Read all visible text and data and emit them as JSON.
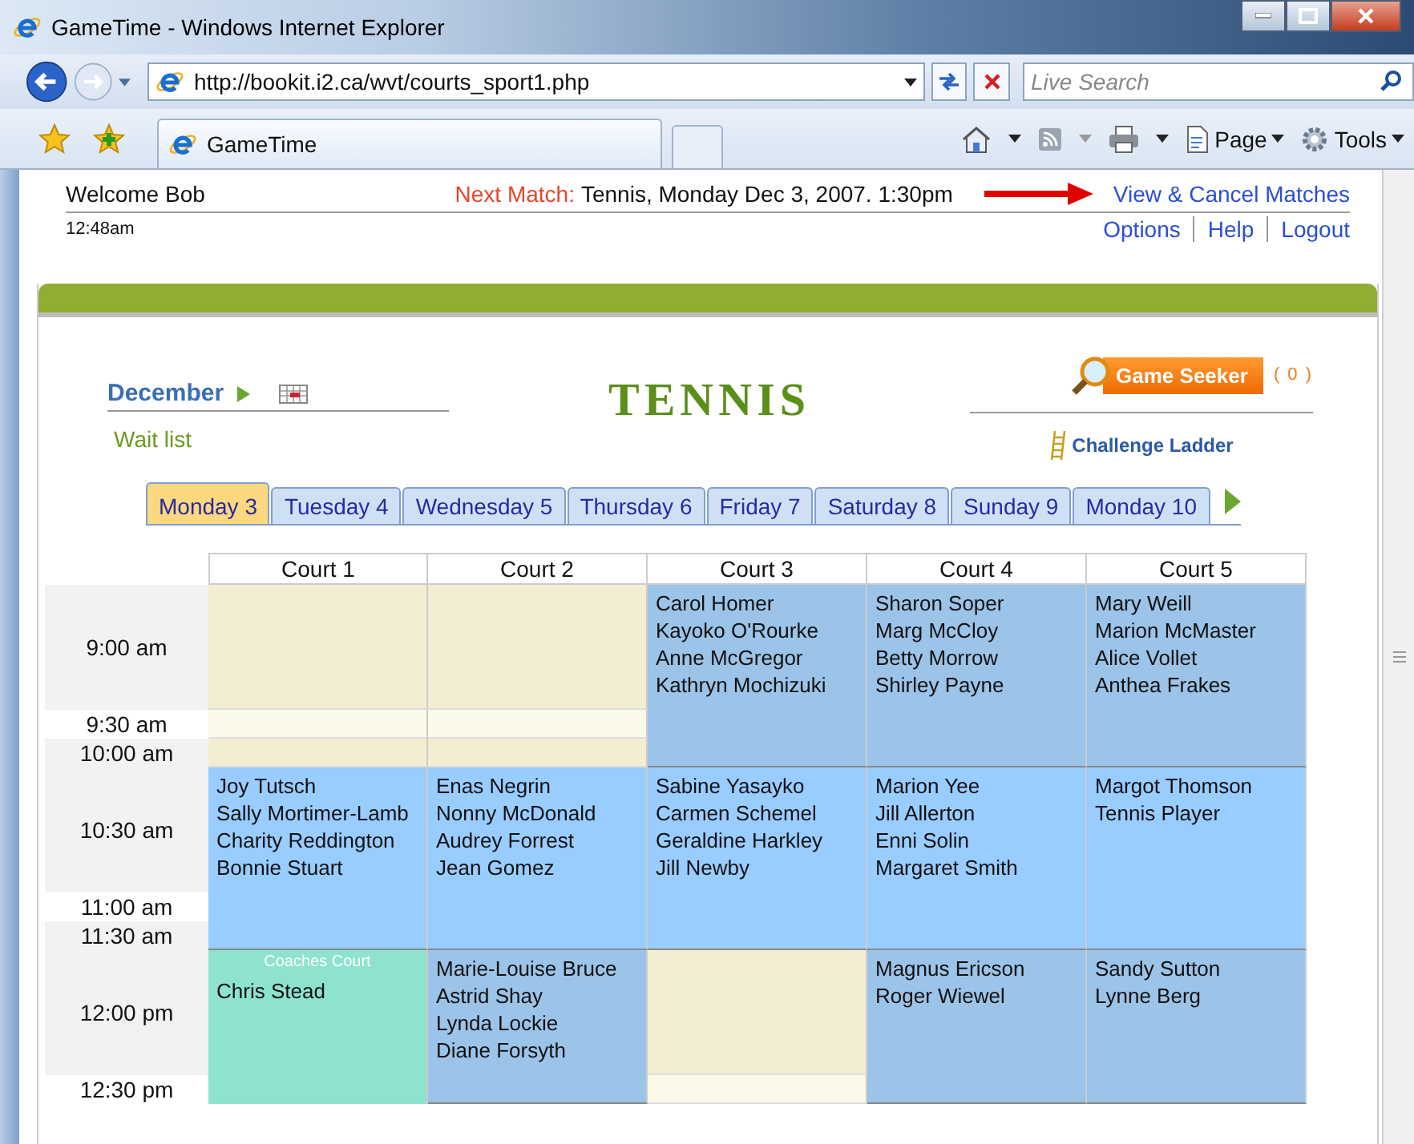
{
  "window": {
    "title": "GameTime - Windows Internet Explorer"
  },
  "address_bar": {
    "url": "http://bookit.i2.ca/wvt/courts_sport1.php",
    "search_placeholder": "Live Search"
  },
  "browser_tab": {
    "title": "GameTime"
  },
  "command_bar": [
    {
      "label": "Page",
      "kind": "page"
    },
    {
      "label": "Tools",
      "kind": "tools"
    }
  ],
  "header": {
    "welcome": "Welcome Bob",
    "time": "12:48am",
    "next_match_label": "Next Match:",
    "next_match": "Tennis, Monday Dec 3, 2007. 1:30pm",
    "view_link": "View & Cancel Matches",
    "nav": [
      "Options",
      "Help",
      "Logout"
    ]
  },
  "panel": {
    "month": "December",
    "wait_list": "Wait list",
    "sport": "TENNIS",
    "game_seeker": "Game Seeker",
    "seeker_count": "( 0 )",
    "challenge_ladder": "Challenge Ladder"
  },
  "days": [
    {
      "label": "Monday 3",
      "selected": true
    },
    {
      "label": "Tuesday 4",
      "selected": false
    },
    {
      "label": "Wednesday 5",
      "selected": false
    },
    {
      "label": "Thursday 6",
      "selected": false
    },
    {
      "label": "Friday 7",
      "selected": false
    },
    {
      "label": "Saturday 8",
      "selected": false
    },
    {
      "label": "Sunday 9",
      "selected": false
    },
    {
      "label": "Monday 10",
      "selected": false
    }
  ],
  "schedule": {
    "columns": [
      "Court 1",
      "Court 2",
      "Court 3",
      "Court 4",
      "Court 5"
    ],
    "blocks": [
      {
        "times": [
          "9:00 am",
          "9:30 am",
          "10:00 am"
        ],
        "cells": [
          {
            "kind": "open"
          },
          {
            "kind": "open"
          },
          {
            "kind": "booked",
            "players": [
              "Carol Homer",
              "Kayoko O'Rourke",
              "Anne McGregor",
              "Kathryn Mochizuki"
            ]
          },
          {
            "kind": "booked",
            "players": [
              "Sharon Soper",
              "Marg McCloy",
              "Betty Morrow",
              "Shirley Payne"
            ]
          },
          {
            "kind": "booked",
            "players": [
              "Mary Weill",
              "Marion McMaster",
              "Alice Vollet",
              "Anthea Frakes"
            ]
          }
        ]
      },
      {
        "times": [
          "10:30 am",
          "11:00 am",
          "11:30 am"
        ],
        "cells": [
          {
            "kind": "booked",
            "players": [
              "Joy Tutsch",
              "Sally Mortimer-Lamb",
              "Charity Reddington",
              "Bonnie Stuart"
            ]
          },
          {
            "kind": "booked",
            "players": [
              "Enas Negrin",
              "Nonny McDonald",
              "Audrey Forrest",
              "Jean Gomez"
            ]
          },
          {
            "kind": "booked",
            "players": [
              "Sabine Yasayko",
              "Carmen Schemel",
              "Geraldine Harkley",
              "Jill Newby"
            ]
          },
          {
            "kind": "booked",
            "players": [
              "Marion Yee",
              "Jill Allerton",
              "Enni Solin",
              "Margaret Smith"
            ]
          },
          {
            "kind": "booked",
            "players": [
              "Margot Thomson",
              "Tennis Player"
            ]
          }
        ]
      },
      {
        "times": [
          "12:00 pm",
          "12:30 pm"
        ],
        "cells": [
          {
            "kind": "coaching",
            "label": "Coaches Court",
            "players": [
              "Chris Stead"
            ]
          },
          {
            "kind": "booked",
            "players": [
              "Marie-Louise Bruce",
              "Astrid Shay",
              "Lynda Lockie",
              "Diane Forsyth"
            ]
          },
          {
            "kind": "open"
          },
          {
            "kind": "booked",
            "players": [
              "Magnus Ericson",
              "Roger Wiewel"
            ]
          },
          {
            "kind": "booked",
            "players": [
              "Sandy Sutton",
              "Lynne Berg"
            ]
          }
        ]
      }
    ]
  }
}
